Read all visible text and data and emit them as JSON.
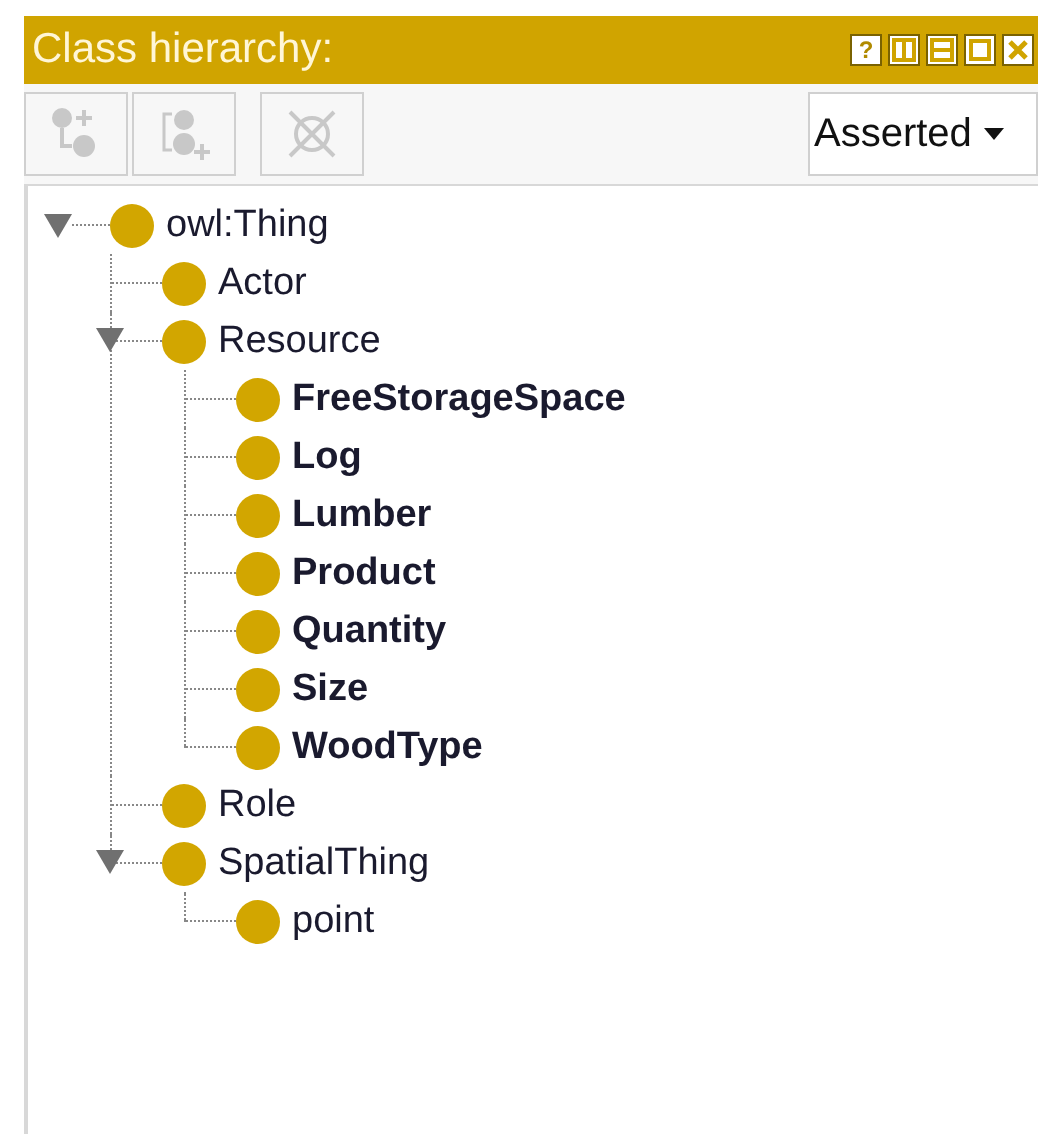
{
  "panel": {
    "title": "Class hierarchy:"
  },
  "header_buttons": [
    {
      "kind": "help",
      "label": "?"
    },
    {
      "kind": "split-vertical"
    },
    {
      "kind": "split-horizontal"
    },
    {
      "kind": "maximize"
    },
    {
      "kind": "close"
    }
  ],
  "toolbar": [
    {
      "kind": "add-subclass",
      "disabled": true
    },
    {
      "kind": "add-sibling",
      "disabled": true
    },
    {
      "kind": "delete",
      "disabled": true
    }
  ],
  "view_select": {
    "value": "Asserted"
  },
  "tree": [
    {
      "label": "owl:Thing",
      "bold": false,
      "expanded": true,
      "children": [
        {
          "label": "Actor",
          "bold": false
        },
        {
          "label": "Resource",
          "bold": false,
          "expanded": true,
          "children": [
            {
              "label": "FreeStorageSpace",
              "bold": true
            },
            {
              "label": "Log",
              "bold": true
            },
            {
              "label": "Lumber",
              "bold": true
            },
            {
              "label": "Product",
              "bold": true
            },
            {
              "label": "Quantity",
              "bold": true
            },
            {
              "label": "Size",
              "bold": true
            },
            {
              "label": "WoodType",
              "bold": true
            }
          ]
        },
        {
          "label": "Role",
          "bold": false
        },
        {
          "label": "SpatialThing",
          "bold": false,
          "expanded": true,
          "children": [
            {
              "label": "point",
              "bold": false
            }
          ]
        }
      ]
    }
  ]
}
